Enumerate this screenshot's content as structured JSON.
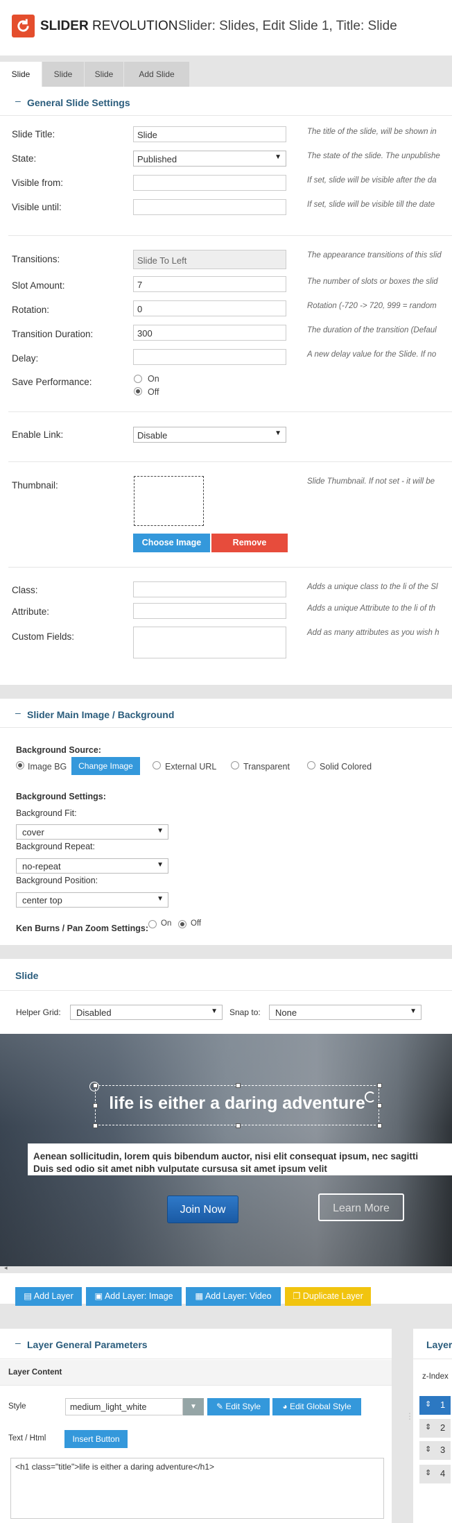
{
  "header": {
    "logo_bold": "SLIDER",
    "logo_rest": " REVOLUTION",
    "title": "Slider: Slides, Edit Slide 1, Title: Slide"
  },
  "tabs": [
    {
      "label": "Slide"
    },
    {
      "label": "Slide"
    },
    {
      "label": "Slide"
    },
    {
      "label": "Add Slide"
    }
  ],
  "general": {
    "heading": "General Slide Settings",
    "fields": {
      "slide_title": {
        "label": "Slide Title:",
        "value": "Slide",
        "hint": "The title of the slide, will be shown in"
      },
      "state": {
        "label": "State:",
        "value": "Published",
        "hint": "The state of the slide. The unpublishe"
      },
      "visible_from": {
        "label": "Visible from:",
        "value": "",
        "hint": "If set, slide will be visible after the da"
      },
      "visible_until": {
        "label": "Visible until:",
        "value": "",
        "hint": "If set, slide will be visible till the date"
      },
      "transitions": {
        "label": "Transitions:",
        "value": "Slide To Left",
        "hint": "The appearance transitions of this slid"
      },
      "slot_amount": {
        "label": "Slot Amount:",
        "value": "7",
        "hint": "The number of slots or boxes the slid"
      },
      "rotation": {
        "label": "Rotation:",
        "value": "0",
        "hint": "Rotation (-720 -> 720, 999 = random"
      },
      "transition_duration": {
        "label": "Transition Duration:",
        "value": "300",
        "hint": "The duration of the transition (Defaul"
      },
      "delay": {
        "label": "Delay:",
        "value": "",
        "hint": "A new delay value for the Slide. If no"
      },
      "save_performance": {
        "label": "Save Performance:",
        "on": "On",
        "off": "Off",
        "selected": "Off"
      },
      "enable_link": {
        "label": "Enable Link:",
        "value": "Disable"
      },
      "thumbnail": {
        "label": "Thumbnail:",
        "hint": "Slide Thumbnail. If not set - it will be",
        "choose": "Choose Image",
        "remove": "Remove"
      },
      "class": {
        "label": "Class:",
        "value": "",
        "hint": "Adds a unique class to the li of the Sl"
      },
      "attribute": {
        "label": "Attribute:",
        "value": "",
        "hint": "Adds a unique Attribute to the li of th"
      },
      "custom_fields": {
        "label": "Custom Fields:",
        "value": "",
        "hint": "Add as many attributes as you wish h"
      }
    }
  },
  "background": {
    "heading": "Slider Main Image / Background",
    "source_label": "Background Source:",
    "options": [
      "Image BG",
      "External URL",
      "Transparent",
      "Solid Colored"
    ],
    "selected": "Image BG",
    "change_image": "Change Image",
    "settings_label": "Background Settings:",
    "fit_label": "Background Fit:",
    "fit_value": "cover",
    "repeat_label": "Background Repeat:",
    "repeat_value": "no-repeat",
    "position_label": "Background Position:",
    "position_value": "center top",
    "kenburns_label": "Ken Burns / Pan Zoom Settings:",
    "kenburns_on": "On",
    "kenburns_off": "Off",
    "kenburns_selected": "Off"
  },
  "slide_editor": {
    "heading": "Slide",
    "helper_grid_label": "Helper Grid:",
    "helper_grid_value": "Disabled",
    "snap_label": "Snap to:",
    "snap_value": "None",
    "layer_title": "life is either a daring adventure",
    "layer_paragraph_1": "Aenean sollicitudin, lorem quis bibendum auctor, nisi elit consequat ipsum, nec sagitti",
    "layer_paragraph_2": "Duis sed odio sit amet nibh vulputate cursusa sit amet ipsum velit",
    "join_button": "Join Now",
    "learn_button": "Learn More"
  },
  "layer_buttons": {
    "add_layer": "Add Layer",
    "add_image": "Add Layer: Image",
    "add_video": "Add Layer: Video",
    "duplicate": "Duplicate Layer"
  },
  "layer_params": {
    "heading": "Layer General Parameters",
    "content_heading": "Layer Content",
    "style_label": "Style",
    "style_value": "medium_light_white",
    "edit_style": "Edit Style",
    "edit_global_style": "Edit Global Style",
    "text_label": "Text / Html",
    "insert_button": "Insert Button",
    "html_value": "<h1 class=\"title\">life is either a daring adventure</h1>"
  },
  "layers_panel": {
    "heading": "Layer",
    "zindex_label": "z-Index",
    "items": [
      "1",
      "2",
      "3",
      "4"
    ]
  },
  "colors": {
    "brand": "#e44e2d",
    "heading": "#2a5c7c",
    "primary_button": "#3498db",
    "danger_button": "#e74c3c",
    "warning_button": "#f1c40f"
  }
}
